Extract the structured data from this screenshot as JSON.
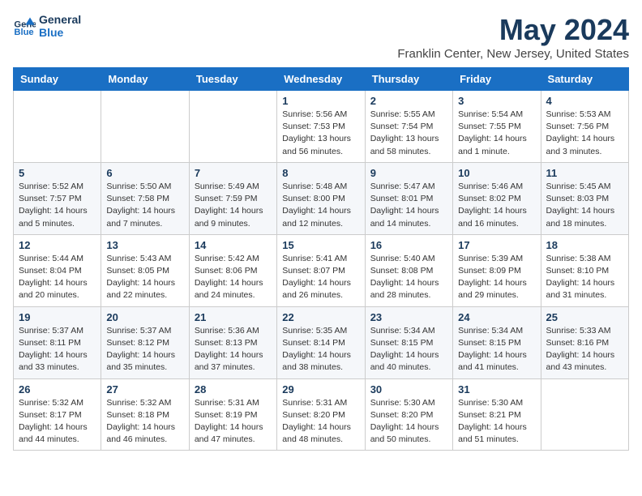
{
  "header": {
    "logo_line1": "General",
    "logo_line2": "Blue",
    "title": "May 2024",
    "subtitle": "Franklin Center, New Jersey, United States"
  },
  "weekdays": [
    "Sunday",
    "Monday",
    "Tuesday",
    "Wednesday",
    "Thursday",
    "Friday",
    "Saturday"
  ],
  "weeks": [
    [
      {
        "day": "",
        "info": ""
      },
      {
        "day": "",
        "info": ""
      },
      {
        "day": "",
        "info": ""
      },
      {
        "day": "1",
        "info": "Sunrise: 5:56 AM\nSunset: 7:53 PM\nDaylight: 13 hours\nand 56 minutes."
      },
      {
        "day": "2",
        "info": "Sunrise: 5:55 AM\nSunset: 7:54 PM\nDaylight: 13 hours\nand 58 minutes."
      },
      {
        "day": "3",
        "info": "Sunrise: 5:54 AM\nSunset: 7:55 PM\nDaylight: 14 hours\nand 1 minute."
      },
      {
        "day": "4",
        "info": "Sunrise: 5:53 AM\nSunset: 7:56 PM\nDaylight: 14 hours\nand 3 minutes."
      }
    ],
    [
      {
        "day": "5",
        "info": "Sunrise: 5:52 AM\nSunset: 7:57 PM\nDaylight: 14 hours\nand 5 minutes."
      },
      {
        "day": "6",
        "info": "Sunrise: 5:50 AM\nSunset: 7:58 PM\nDaylight: 14 hours\nand 7 minutes."
      },
      {
        "day": "7",
        "info": "Sunrise: 5:49 AM\nSunset: 7:59 PM\nDaylight: 14 hours\nand 9 minutes."
      },
      {
        "day": "8",
        "info": "Sunrise: 5:48 AM\nSunset: 8:00 PM\nDaylight: 14 hours\nand 12 minutes."
      },
      {
        "day": "9",
        "info": "Sunrise: 5:47 AM\nSunset: 8:01 PM\nDaylight: 14 hours\nand 14 minutes."
      },
      {
        "day": "10",
        "info": "Sunrise: 5:46 AM\nSunset: 8:02 PM\nDaylight: 14 hours\nand 16 minutes."
      },
      {
        "day": "11",
        "info": "Sunrise: 5:45 AM\nSunset: 8:03 PM\nDaylight: 14 hours\nand 18 minutes."
      }
    ],
    [
      {
        "day": "12",
        "info": "Sunrise: 5:44 AM\nSunset: 8:04 PM\nDaylight: 14 hours\nand 20 minutes."
      },
      {
        "day": "13",
        "info": "Sunrise: 5:43 AM\nSunset: 8:05 PM\nDaylight: 14 hours\nand 22 minutes."
      },
      {
        "day": "14",
        "info": "Sunrise: 5:42 AM\nSunset: 8:06 PM\nDaylight: 14 hours\nand 24 minutes."
      },
      {
        "day": "15",
        "info": "Sunrise: 5:41 AM\nSunset: 8:07 PM\nDaylight: 14 hours\nand 26 minutes."
      },
      {
        "day": "16",
        "info": "Sunrise: 5:40 AM\nSunset: 8:08 PM\nDaylight: 14 hours\nand 28 minutes."
      },
      {
        "day": "17",
        "info": "Sunrise: 5:39 AM\nSunset: 8:09 PM\nDaylight: 14 hours\nand 29 minutes."
      },
      {
        "day": "18",
        "info": "Sunrise: 5:38 AM\nSunset: 8:10 PM\nDaylight: 14 hours\nand 31 minutes."
      }
    ],
    [
      {
        "day": "19",
        "info": "Sunrise: 5:37 AM\nSunset: 8:11 PM\nDaylight: 14 hours\nand 33 minutes."
      },
      {
        "day": "20",
        "info": "Sunrise: 5:37 AM\nSunset: 8:12 PM\nDaylight: 14 hours\nand 35 minutes."
      },
      {
        "day": "21",
        "info": "Sunrise: 5:36 AM\nSunset: 8:13 PM\nDaylight: 14 hours\nand 37 minutes."
      },
      {
        "day": "22",
        "info": "Sunrise: 5:35 AM\nSunset: 8:14 PM\nDaylight: 14 hours\nand 38 minutes."
      },
      {
        "day": "23",
        "info": "Sunrise: 5:34 AM\nSunset: 8:15 PM\nDaylight: 14 hours\nand 40 minutes."
      },
      {
        "day": "24",
        "info": "Sunrise: 5:34 AM\nSunset: 8:15 PM\nDaylight: 14 hours\nand 41 minutes."
      },
      {
        "day": "25",
        "info": "Sunrise: 5:33 AM\nSunset: 8:16 PM\nDaylight: 14 hours\nand 43 minutes."
      }
    ],
    [
      {
        "day": "26",
        "info": "Sunrise: 5:32 AM\nSunset: 8:17 PM\nDaylight: 14 hours\nand 44 minutes."
      },
      {
        "day": "27",
        "info": "Sunrise: 5:32 AM\nSunset: 8:18 PM\nDaylight: 14 hours\nand 46 minutes."
      },
      {
        "day": "28",
        "info": "Sunrise: 5:31 AM\nSunset: 8:19 PM\nDaylight: 14 hours\nand 47 minutes."
      },
      {
        "day": "29",
        "info": "Sunrise: 5:31 AM\nSunset: 8:20 PM\nDaylight: 14 hours\nand 48 minutes."
      },
      {
        "day": "30",
        "info": "Sunrise: 5:30 AM\nSunset: 8:20 PM\nDaylight: 14 hours\nand 50 minutes."
      },
      {
        "day": "31",
        "info": "Sunrise: 5:30 AM\nSunset: 8:21 PM\nDaylight: 14 hours\nand 51 minutes."
      },
      {
        "day": "",
        "info": ""
      }
    ]
  ]
}
